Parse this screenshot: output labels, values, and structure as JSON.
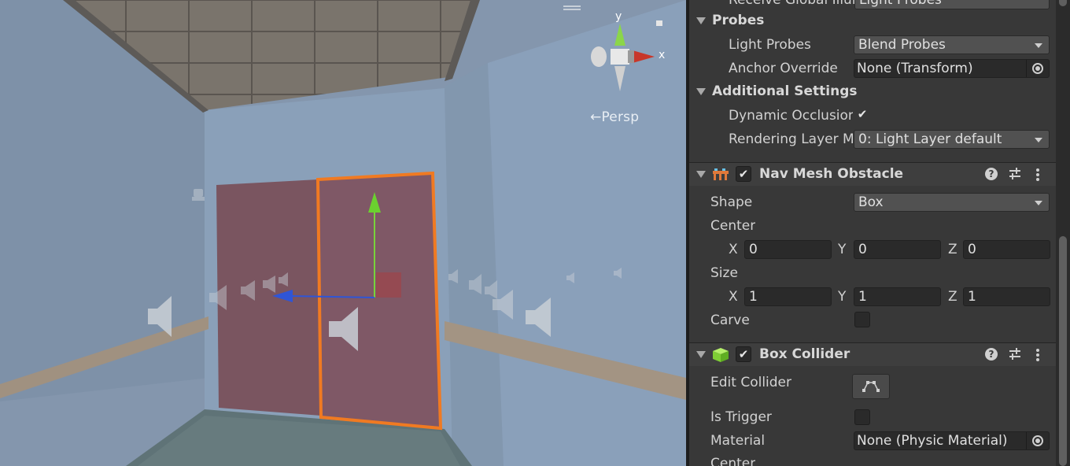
{
  "scene": {
    "view_label": "←Persp",
    "gizmo": {
      "y_label": "y",
      "x_label": "x"
    }
  },
  "inspector": {
    "top_cut_row": {
      "label": "Receive Global Illumination",
      "value": "Light Probes"
    },
    "probes": {
      "title": "Probes",
      "light_probes": {
        "label": "Light Probes",
        "value": "Blend Probes"
      },
      "anchor_override": {
        "label": "Anchor Override",
        "value": "None (Transform)"
      }
    },
    "additional_settings": {
      "title": "Additional Settings",
      "dynamic_occlusion": {
        "label": "Dynamic Occlusion",
        "checked": true
      },
      "rendering_layer_mask": {
        "label": "Rendering Layer Mask",
        "value": "0: Light Layer default"
      }
    },
    "nav_mesh_obstacle": {
      "title": "Nav Mesh Obstacle",
      "enabled": true,
      "shape": {
        "label": "Shape",
        "value": "Box"
      },
      "center": {
        "label": "Center",
        "x": "0",
        "y": "0",
        "z": "0"
      },
      "size": {
        "label": "Size",
        "x": "1",
        "y": "1",
        "z": "1"
      },
      "carve": {
        "label": "Carve",
        "checked": false
      }
    },
    "box_collider": {
      "title": "Box Collider",
      "enabled": true,
      "edit_collider": {
        "label": "Edit Collider"
      },
      "is_trigger": {
        "label": "Is Trigger",
        "checked": false
      },
      "material": {
        "label": "Material",
        "value": "None (Physic Material)"
      },
      "center": {
        "label": "Center"
      }
    },
    "axis_labels": {
      "x": "X",
      "y": "Y",
      "z": "Z"
    },
    "icons": [
      "collapse-triangle-icon",
      "navmesh-obstacle-icon",
      "box-collider-icon",
      "help-icon",
      "presets-icon",
      "more-options-icon",
      "object-picker-icon",
      "checkmark-icon",
      "edit-collider-icon"
    ]
  },
  "colors": {
    "selection_outline": "#f07a22",
    "gizmo_y": "#79d33a",
    "gizmo_x": "#d13a2a",
    "gizmo_z": "#2f55d6",
    "inspector_bg": "#383838"
  }
}
